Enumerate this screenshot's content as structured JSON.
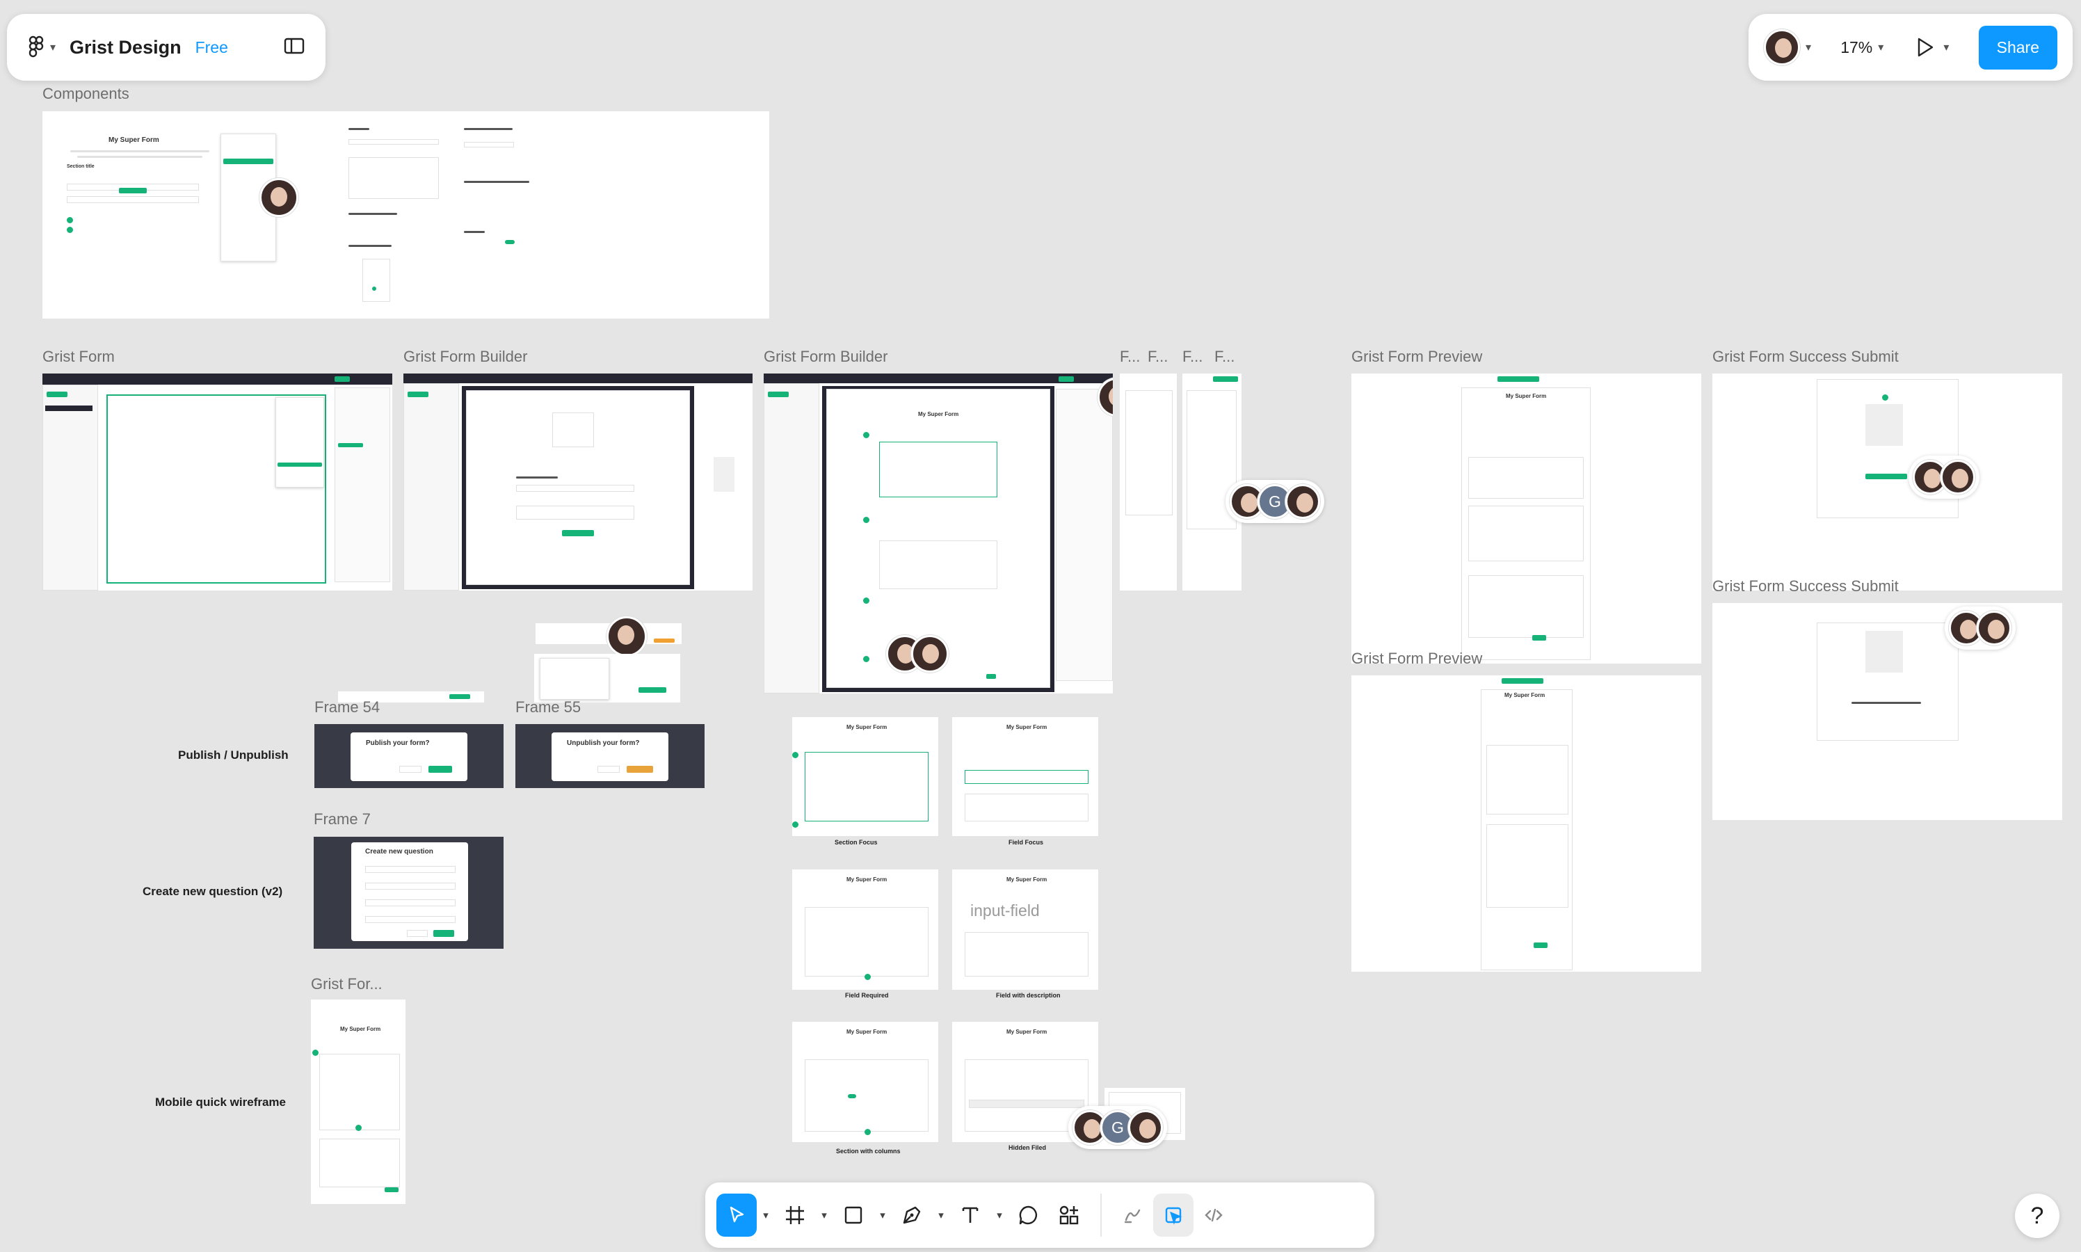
{
  "header": {
    "file_name": "Grist Design",
    "plan": "Free",
    "zoom": "17%",
    "share_label": "Share"
  },
  "frames": {
    "components": "Components",
    "grist_form": "Grist Form",
    "builder_1": "Grist Form Builder",
    "builder_2": "Grist Form Builder",
    "small_1": "F...",
    "small_2": "F...",
    "small_3": "F...",
    "small_4": "F...",
    "preview_1": "Grist Form Preview",
    "preview_2": "Grist Form Preview",
    "success_1": "Grist Form Success Submit",
    "success_2": "Grist Form Success Submit",
    "frame_54": "Frame 54",
    "frame_55": "Frame 55",
    "frame_7": "Frame 7",
    "mobile": "Grist For..."
  },
  "sections": {
    "publish": "Publish / Unpublish",
    "create_question": "Create new question (v2)",
    "mobile": "Mobile quick wireframe"
  },
  "form_content": {
    "title": "My Super Form",
    "section_title": "Section title",
    "publish_modal": "Publish your form?",
    "unpublish_modal": "Unpublish your form?",
    "create_question_modal": "Create new question",
    "hover_label": "input-field"
  },
  "captions": {
    "section_focus": "Section Focus",
    "field_focus": "Field Focus",
    "field_required": "Field Required",
    "field_with_description": "Field with description",
    "section_with_columns": "Section with columns",
    "hidden_filed": "Hidden Filed"
  },
  "collaborators": {
    "g_initial": "G"
  },
  "help": "?"
}
